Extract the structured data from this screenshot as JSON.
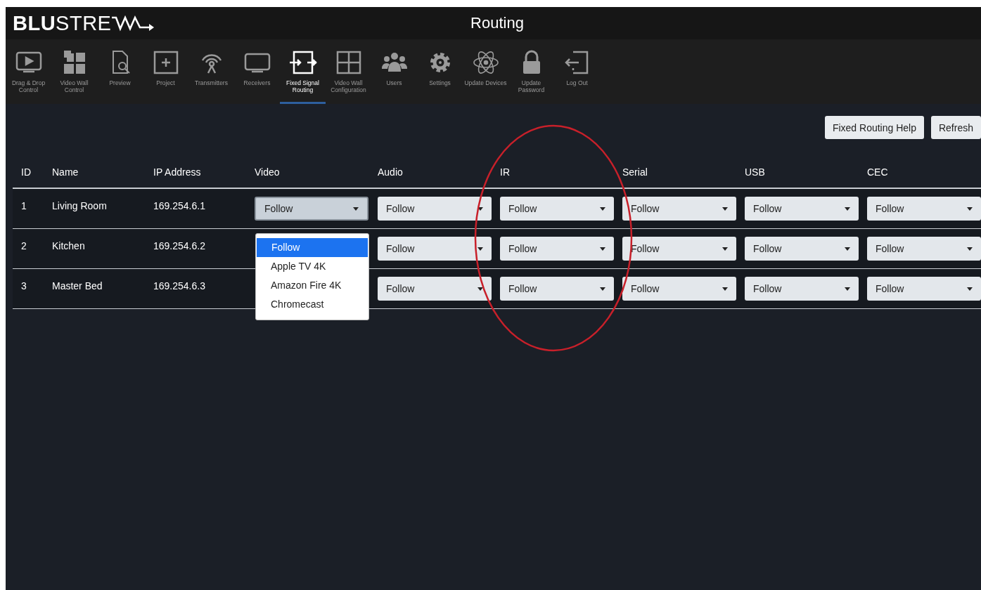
{
  "logo": "**BLU**STRE",
  "window": {
    "title": "Routing"
  },
  "nav": [
    {
      "label": "Drag & Drop Control",
      "selected": false
    },
    {
      "label": "Video Wall Control",
      "selected": false
    },
    {
      "label": "Preview",
      "selected": false
    },
    {
      "label": "Project",
      "selected": false
    },
    {
      "label": "Transmitters",
      "selected": false
    },
    {
      "label": "Receivers",
      "selected": false
    },
    {
      "label": "Fixed Signal Routing",
      "selected": true
    },
    {
      "label": "Video Wall Configuration",
      "selected": false
    },
    {
      "label": "Users",
      "selected": false
    },
    {
      "label": "Settings",
      "selected": false
    },
    {
      "label": "Update Devices",
      "selected": false
    },
    {
      "label": "Update Password",
      "selected": false
    },
    {
      "label": "Log Out",
      "selected": false
    }
  ],
  "buttons": [
    "Fixed Routing Help",
    "Refresh"
  ],
  "table": {
    "columns": [
      "ID",
      "Name",
      "IP Address",
      "Video",
      "Audio",
      "IR",
      "Serial",
      "USB",
      "CEC"
    ],
    "rows": [
      {
        "id": "1",
        "name": "Living Room",
        "ip": "169.254.6.1",
        "video": "Follow",
        "video_open": true,
        "audio": "Follow",
        "ir": "Follow",
        "serial": "Follow",
        "usb": "Follow",
        "cec": "Follow"
      },
      {
        "id": "2",
        "name": "Kitchen",
        "ip": "169.254.6.2",
        "audio": "Follow",
        "ir": "Follow",
        "serial": "Follow",
        "usb": "Follow",
        "cec": "Follow"
      },
      {
        "id": "3",
        "name": "Master Bed",
        "ip": "169.254.6.3",
        "audio": "Follow",
        "ir": "Follow",
        "serial": "Follow",
        "usb": "Follow",
        "cec": "Follow"
      }
    ]
  },
  "dropdown": {
    "options": [
      {
        "label": "Follow",
        "selected": true
      },
      {
        "label": "Apple TV 4K",
        "selected": false
      },
      {
        "label": "Amazon Fire 4K",
        "selected": false
      },
      {
        "label": "Chromecast",
        "selected": false
      }
    ]
  }
}
